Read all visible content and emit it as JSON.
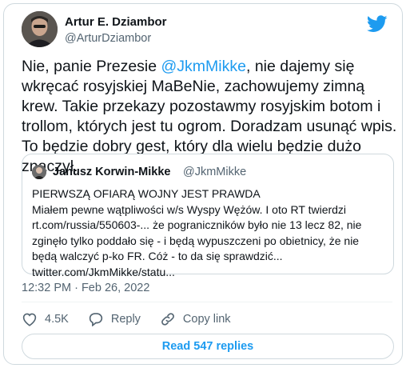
{
  "author": {
    "name": "Artur E. Dziambor",
    "handle": "@ArturDziambor"
  },
  "tweet": {
    "text_before": "Nie, panie Prezesie ",
    "mention": "@JkmMikke",
    "text_after": ", nie dajemy się wkręcać rosyjskiej MaBeNie, zachowujemy zimną krew. Takie przekazy pozostawmy rosyjskim botom i trollom, których jest tu ogrom. Doradzam usunąć wpis. To będzie dobry gest, który dla wielu będzie dużo znaczył."
  },
  "quoted_tweet": {
    "name": "Janusz Korwin-Mikke",
    "handle": "@JkmMikke",
    "lines": [
      "PIERWSZĄ OFIARĄ WOJNY JEST PRAWDA",
      "Miałem pewne wątpliwości w/s Wyspy Wężów. I oto RT twierdzi",
      "rt.com/russia/550603-... że pograniczników było nie 13 lecz 82, nie",
      "zginęło tylko poddało się - i będą wypuszczeni po obietnicy, że nie",
      "będą walczyć p-ko FR. Cóż - to da się sprawdzić...",
      "twitter.com/JkmMikke/statu..."
    ]
  },
  "timestamp": "12:32 PM · Feb 26, 2022",
  "actions": {
    "like_count": "4.5K",
    "reply_label": "Reply",
    "copy_label": "Copy link"
  },
  "read_replies_label": "Read 547 replies",
  "colors": {
    "accent": "#1d9bf0",
    "like": "#f91880",
    "text": "#0f1419",
    "secondary": "#536471",
    "border": "#cfd9de"
  },
  "icons": [
    "twitter-bird-icon",
    "heart-icon",
    "reply-bubble-icon",
    "link-icon"
  ]
}
